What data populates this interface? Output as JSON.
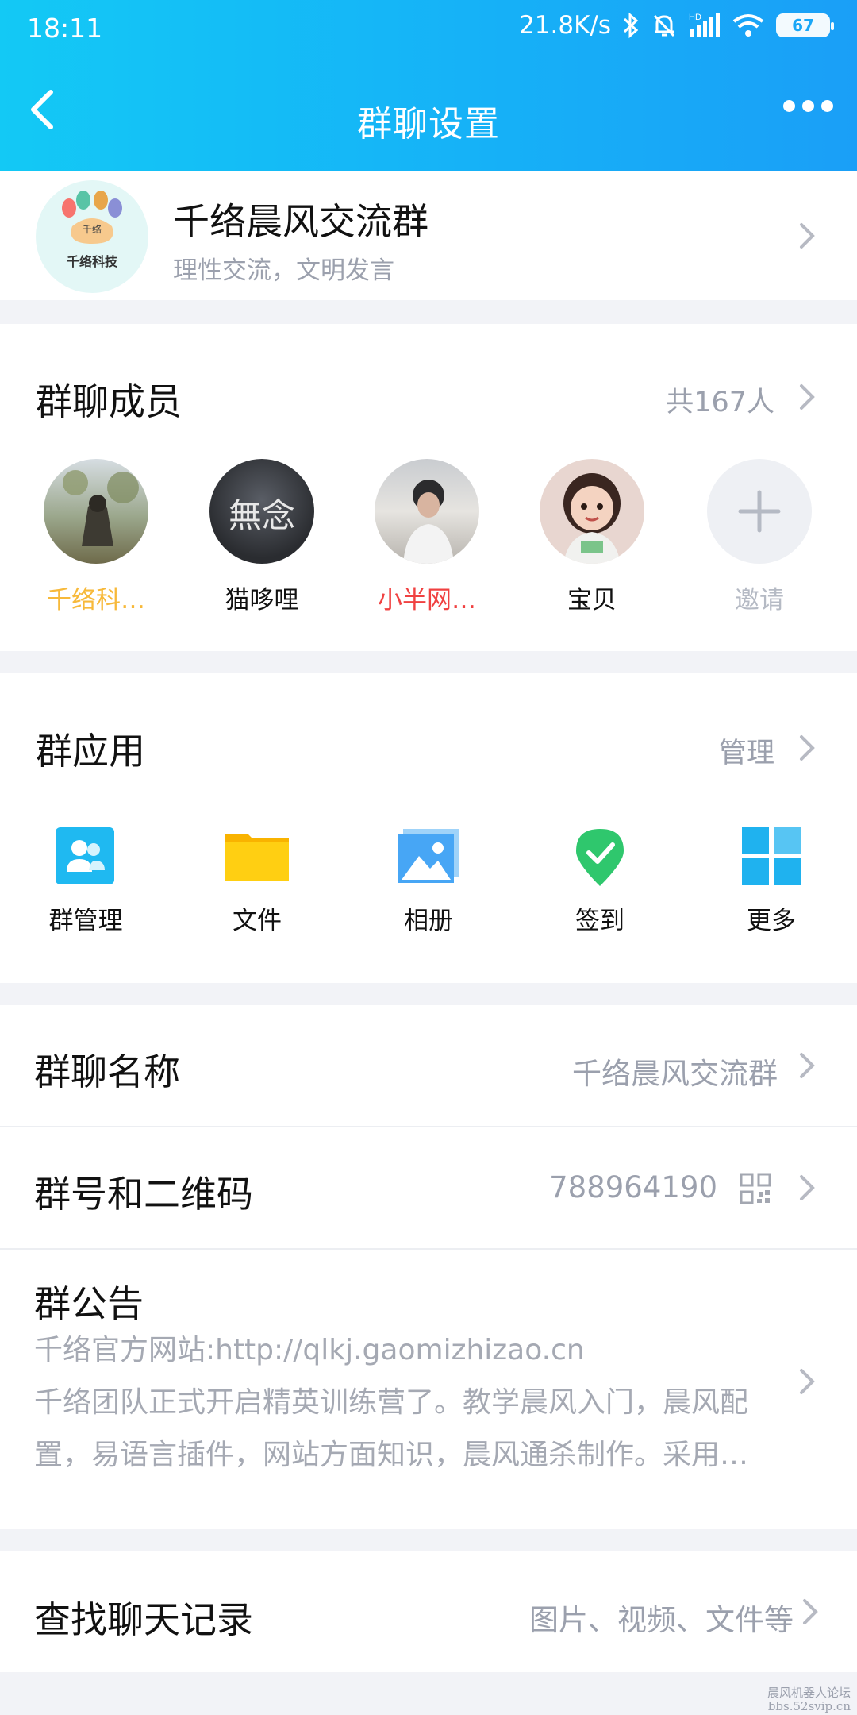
{
  "status_bar": {
    "time": "18:11",
    "speed": "21.8K/s",
    "battery": "67",
    "network": "HD"
  },
  "nav": {
    "title": "群聊设置"
  },
  "group": {
    "name": "千络晨风交流群",
    "desc": "理性交流，文明发言",
    "avatar_text": "千络科技",
    "avatar_inner": "千络"
  },
  "members": {
    "title": "群聊成员",
    "count": "共167人",
    "items": [
      {
        "name": "千络科…",
        "color": "#f7b93a"
      },
      {
        "name": "猫哆哩",
        "color": "#111111",
        "avatar_text": "無念"
      },
      {
        "name": "小半网…",
        "color": "#f04141"
      },
      {
        "name": "宝贝",
        "color": "#111111"
      }
    ],
    "invite_label": "邀请"
  },
  "apps": {
    "title": "群应用",
    "manage_label": "管理",
    "items": [
      {
        "label": "群管理",
        "icon": "group-manage-icon"
      },
      {
        "label": "文件",
        "icon": "folder-icon"
      },
      {
        "label": "相册",
        "icon": "photo-album-icon"
      },
      {
        "label": "签到",
        "icon": "check-in-icon"
      },
      {
        "label": "更多",
        "icon": "more-apps-icon"
      }
    ]
  },
  "rows": {
    "name": {
      "title": "群聊名称",
      "value": "千络晨风交流群"
    },
    "number": {
      "title": "群号和二维码",
      "value": "788964190"
    },
    "notice": {
      "title": "群公告",
      "line1": "千络官方网站:http://qlkj.gaomizhizao.cn",
      "line2": "千络团队正式开启精英训练营了。教学晨风入门，晨风配",
      "line3": "置，易语言插件，网站方面知识，晨风通杀制作。采用…"
    },
    "history": {
      "title": "查找聊天记录",
      "value": "图片、视频、文件等"
    }
  },
  "watermark": {
    "line1": "晨风机器人论坛",
    "line2": "bbs.52svip.cn"
  },
  "colors": {
    "header_start": "#13c9f5",
    "header_end": "#1a9ff7",
    "gray_text": "#9ba0ad"
  }
}
